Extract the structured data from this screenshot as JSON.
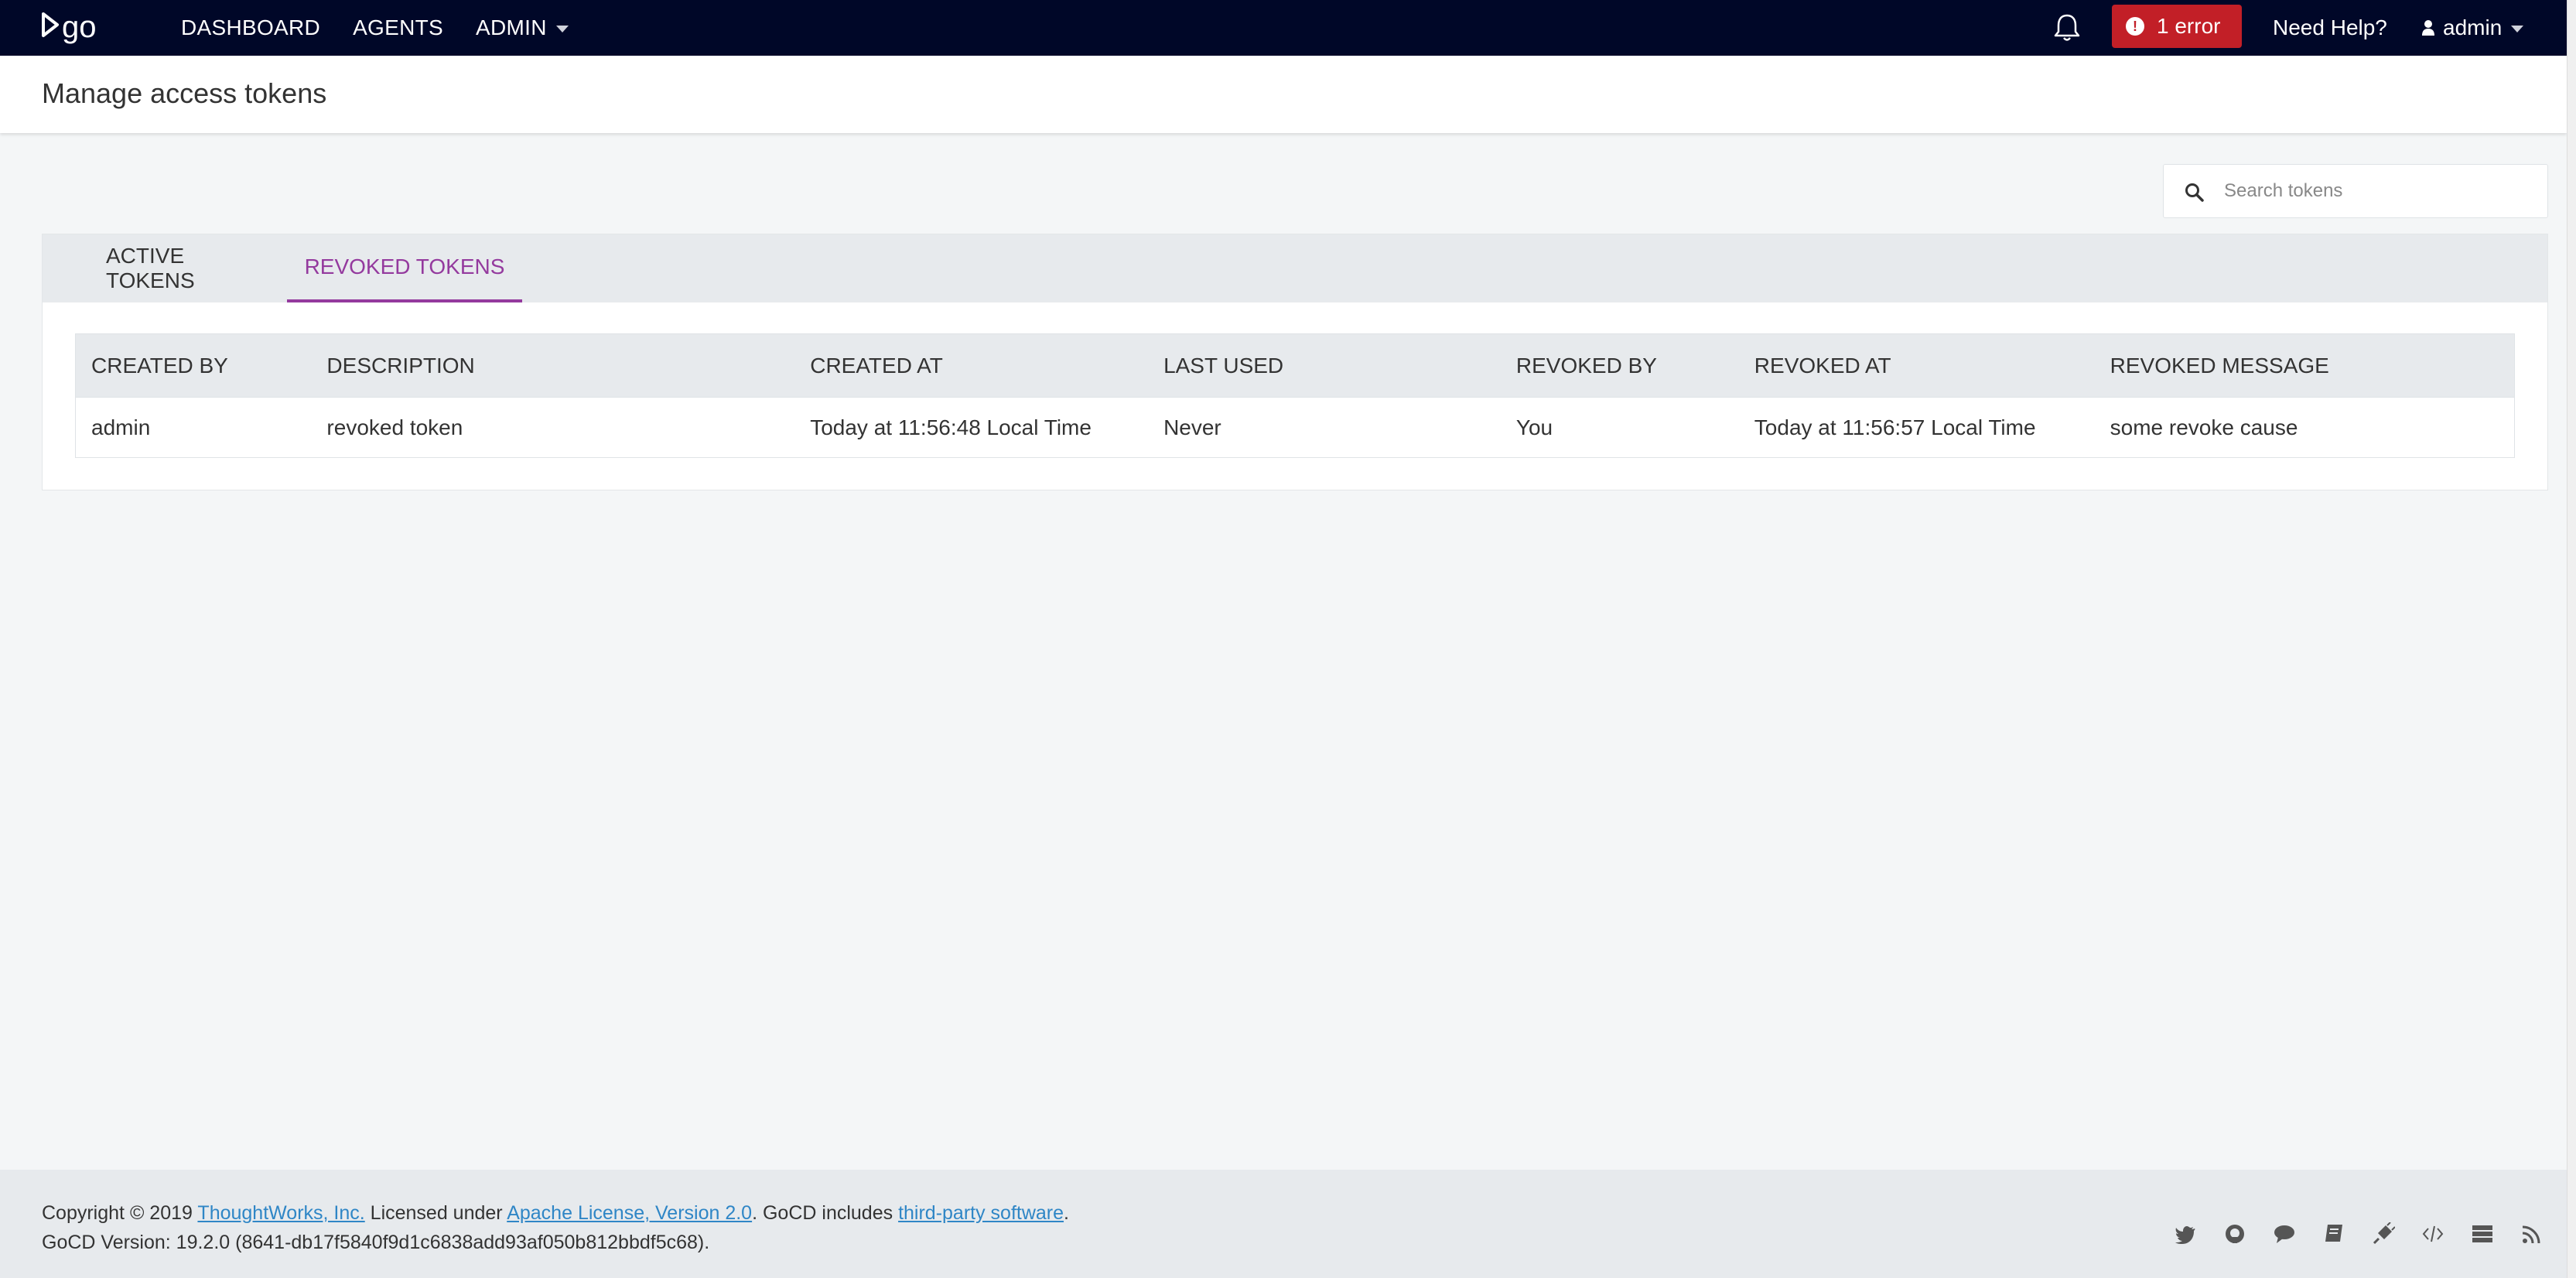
{
  "header": {
    "nav": [
      "DASHBOARD",
      "AGENTS",
      "ADMIN"
    ],
    "error_badge": "1 error",
    "help": "Need Help?",
    "user": "admin"
  },
  "page": {
    "title": "Manage access tokens"
  },
  "search": {
    "placeholder": "Search tokens",
    "value": ""
  },
  "tabs": [
    {
      "label": "ACTIVE TOKENS",
      "active": false
    },
    {
      "label": "REVOKED TOKENS",
      "active": true
    }
  ],
  "table": {
    "columns": [
      "CREATED BY",
      "DESCRIPTION",
      "CREATED AT",
      "LAST USED",
      "REVOKED BY",
      "REVOKED AT",
      "REVOKED MESSAGE"
    ],
    "rows": [
      [
        "admin",
        "revoked token",
        "Today at 11:56:48 Local Time",
        "Never",
        "You",
        "Today at 11:56:57 Local Time",
        "some revoke cause"
      ]
    ]
  },
  "footer": {
    "copyright_prefix": "Copyright © 2019 ",
    "company_link": "ThoughtWorks, Inc.",
    "licensed_text": " Licensed under ",
    "license_link": "Apache License, Version 2.0",
    "includes_text": ". GoCD includes ",
    "third_party_link": "third-party software",
    "period": ".",
    "version": "GoCD Version: 19.2.0 (8641-db17f5840f9d1c6838add93af050b812bbdf5c68)."
  },
  "colors": {
    "topbar": "#000728",
    "error": "#c21f27",
    "accent": "#943a9e",
    "link": "#2f86c6"
  },
  "icons": [
    "go-logo",
    "bell-icon",
    "error-icon",
    "user-icon",
    "search-icon",
    "twitter-icon",
    "github-icon",
    "chat-icon",
    "book-icon",
    "plugin-icon",
    "code-icon",
    "server-icon",
    "rss-icon"
  ]
}
